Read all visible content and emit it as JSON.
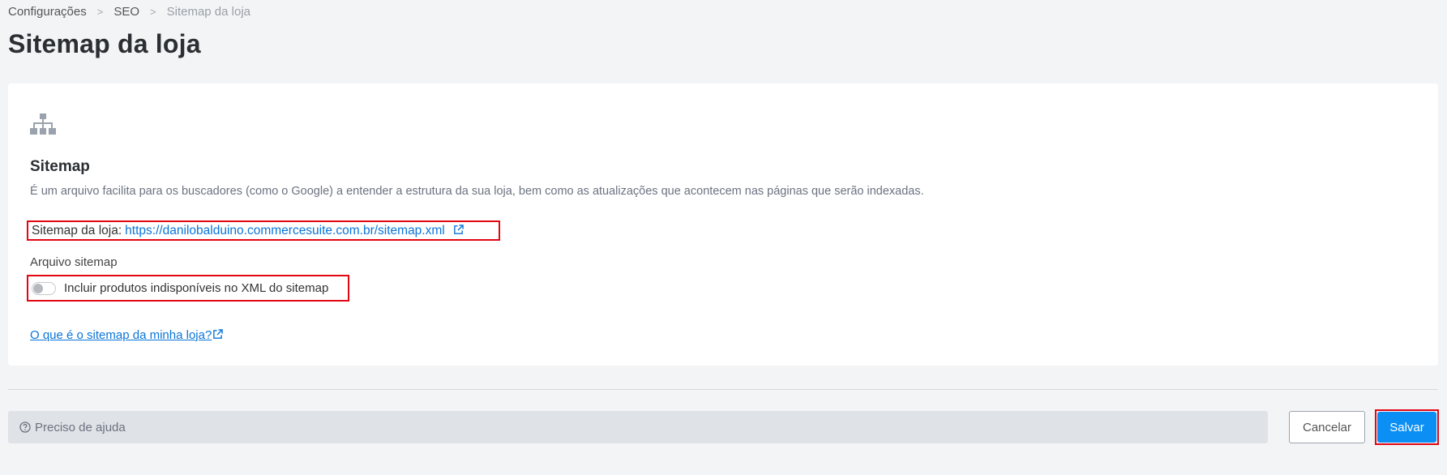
{
  "breadcrumb": {
    "items": [
      "Configurações",
      "SEO",
      "Sitemap da loja"
    ]
  },
  "page": {
    "title": "Sitemap da loja"
  },
  "card": {
    "icon": "sitemap-icon",
    "title": "Sitemap",
    "description": "É um arquivo facilita para os buscadores (como o Google) a entender a estrutura da sua loja, bem como as atualizações que acontecem nas páginas que serão indexadas.",
    "sitemap_label": "Sitemap da loja:",
    "sitemap_url": "https://danilobalduino.commercesuite.com.br/sitemap.xml",
    "arquivo_label": "Arquivo sitemap",
    "toggle_label": "Incluir produtos indisponíveis no XML do sitemap",
    "toggle_on": false,
    "help_link": "O que é o sitemap da minha loja?"
  },
  "footer": {
    "help_text": "Preciso de ajuda",
    "cancel_label": "Cancelar",
    "save_label": "Salvar"
  },
  "colors": {
    "link": "#0a74d8",
    "primary": "#0b8ff5",
    "highlight": "#e30613"
  }
}
